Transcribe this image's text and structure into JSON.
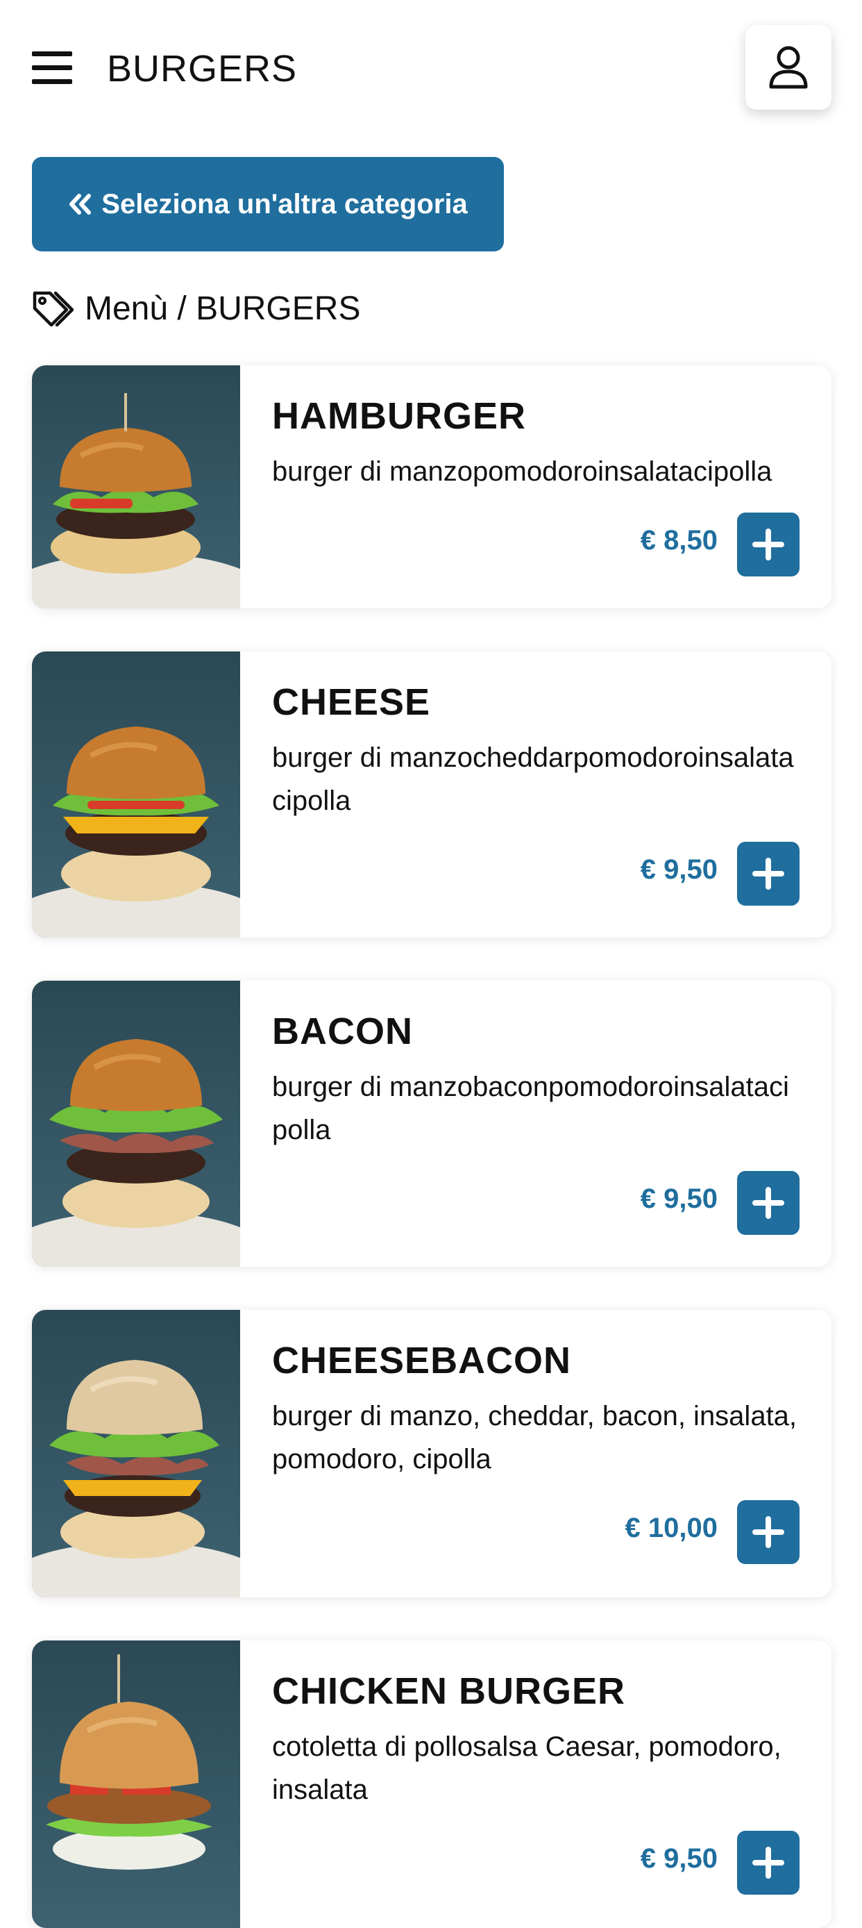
{
  "header": {
    "title": "BURGERS"
  },
  "category_button": {
    "label": "Seleziona un'altra categoria"
  },
  "breadcrumb": {
    "text": "Menù / BURGERS"
  },
  "products": [
    {
      "name": "HAMBURGER",
      "description": "burger di manzopomodoroinsalatacipolla",
      "price": "€ 8,50"
    },
    {
      "name": "CHEESE",
      "description": "burger di manzocheddarpomodoroinsalatacipolla",
      "price": "€ 9,50"
    },
    {
      "name": "BACON",
      "description": "burger di manzobaconpomodoroinsalatacipolla",
      "price": "€ 9,50"
    },
    {
      "name": "CHEESEBACON",
      "description": "burger di manzo, cheddar, bacon, insalata, pomodoro, cipolla",
      "price": "€ 10,00"
    },
    {
      "name": "CHICKEN BURGER",
      "description": "cotoletta di pollosalsa Caesar, pomodoro, insalata",
      "price": "€ 9,50"
    }
  ],
  "colors": {
    "accent": "#1f6e9e",
    "photo_background": "#2c4f5e"
  },
  "icons": {
    "menu": "hamburger-menu-icon",
    "user": "user-icon",
    "back": "double-chevron-left-icon",
    "tag": "tags-icon",
    "add": "plus-icon"
  }
}
